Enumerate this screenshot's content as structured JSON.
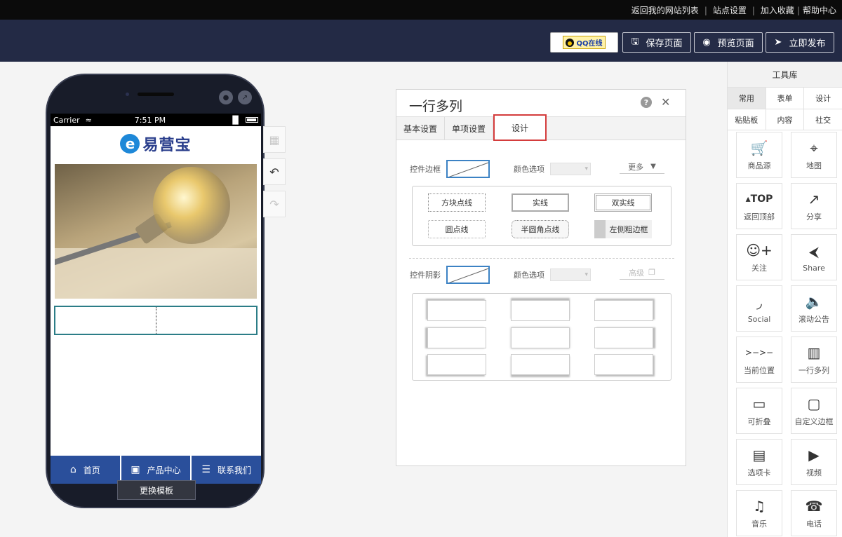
{
  "topbar": {
    "links": [
      "返回我的网站列表",
      "站点设置",
      "加入收藏",
      "帮助中心"
    ]
  },
  "navbar": {
    "qq_label": "QQ在线",
    "save_label": "保存页面",
    "preview_label": "预览页面",
    "publish_label": "立即发布"
  },
  "phone": {
    "carrier": "Carrier",
    "time": "7:51 PM",
    "logo_text": "易营宝",
    "tabs": [
      {
        "icon": "home-icon",
        "label": "首页"
      },
      {
        "icon": "gallery-icon",
        "label": "产品中心"
      },
      {
        "icon": "list-icon",
        "label": "联系我们"
      }
    ],
    "change_template": "更换模板"
  },
  "dialog": {
    "title": "一行多列",
    "tabs": [
      "基本设置",
      "单项设置",
      "设计"
    ],
    "active_tab": "设计",
    "border_label": "控件边框",
    "color_label": "颜色选项",
    "more_label": "更多",
    "border_options": [
      "方块点线",
      "实线",
      "双实线",
      "圆点线",
      "半圆角点线",
      "左侧粗边框"
    ],
    "shadow_label": "控件阴影",
    "shadow_color_label": "颜色选项",
    "advanced_label": "高级"
  },
  "toolbox": {
    "title": "工具库",
    "categories_row1": [
      "常用",
      "表单",
      "设计"
    ],
    "categories_row2": [
      "粘贴板",
      "内容",
      "社交"
    ],
    "active_category": "常用",
    "tools": [
      {
        "icon": "cart-icon",
        "label": "商品源"
      },
      {
        "icon": "map-icon",
        "label": "地图"
      },
      {
        "icon": "top-icon",
        "label": "返回顶部"
      },
      {
        "icon": "share-out-icon",
        "label": "分享"
      },
      {
        "icon": "follow-icon",
        "label": "关注"
      },
      {
        "icon": "share-icon",
        "label": "Share"
      },
      {
        "icon": "rss-icon",
        "label": "Social"
      },
      {
        "icon": "speaker-icon",
        "label": "滚动公告"
      },
      {
        "icon": "breadcrumb-icon",
        "label": "当前位置"
      },
      {
        "icon": "columns-icon",
        "label": "一行多列"
      },
      {
        "icon": "fold-icon",
        "label": "可折叠"
      },
      {
        "icon": "frame-icon",
        "label": "自定义边框"
      },
      {
        "icon": "tabs-icon",
        "label": "选项卡"
      },
      {
        "icon": "video-icon",
        "label": "视频"
      },
      {
        "icon": "music-icon",
        "label": "音乐"
      },
      {
        "icon": "phone-icon",
        "label": "电话"
      }
    ]
  }
}
